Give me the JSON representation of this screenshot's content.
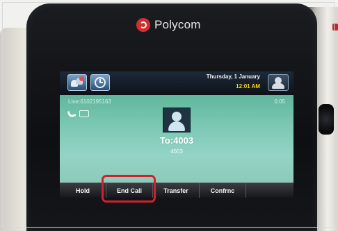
{
  "brand": {
    "name": "Polycom",
    "logo_color": "#d32f2f"
  },
  "status_bar": {
    "date": "Thursday, 1 January",
    "time": "12:01 AM",
    "icons": [
      "contacts-icon",
      "clock-icon",
      "profile-icon"
    ]
  },
  "call": {
    "line": "Line:6102195163",
    "duration": "0:05",
    "to": "To:4003",
    "number": "4003"
  },
  "softkeys": [
    {
      "label": "Hold"
    },
    {
      "label": "End Call"
    },
    {
      "label": "Transfer"
    },
    {
      "label": "Confrnc"
    },
    {
      "label": ""
    }
  ],
  "colors": {
    "call_background": "#7cc8b3",
    "time_accent": "#ffd21a",
    "highlight": "#d3212b"
  }
}
